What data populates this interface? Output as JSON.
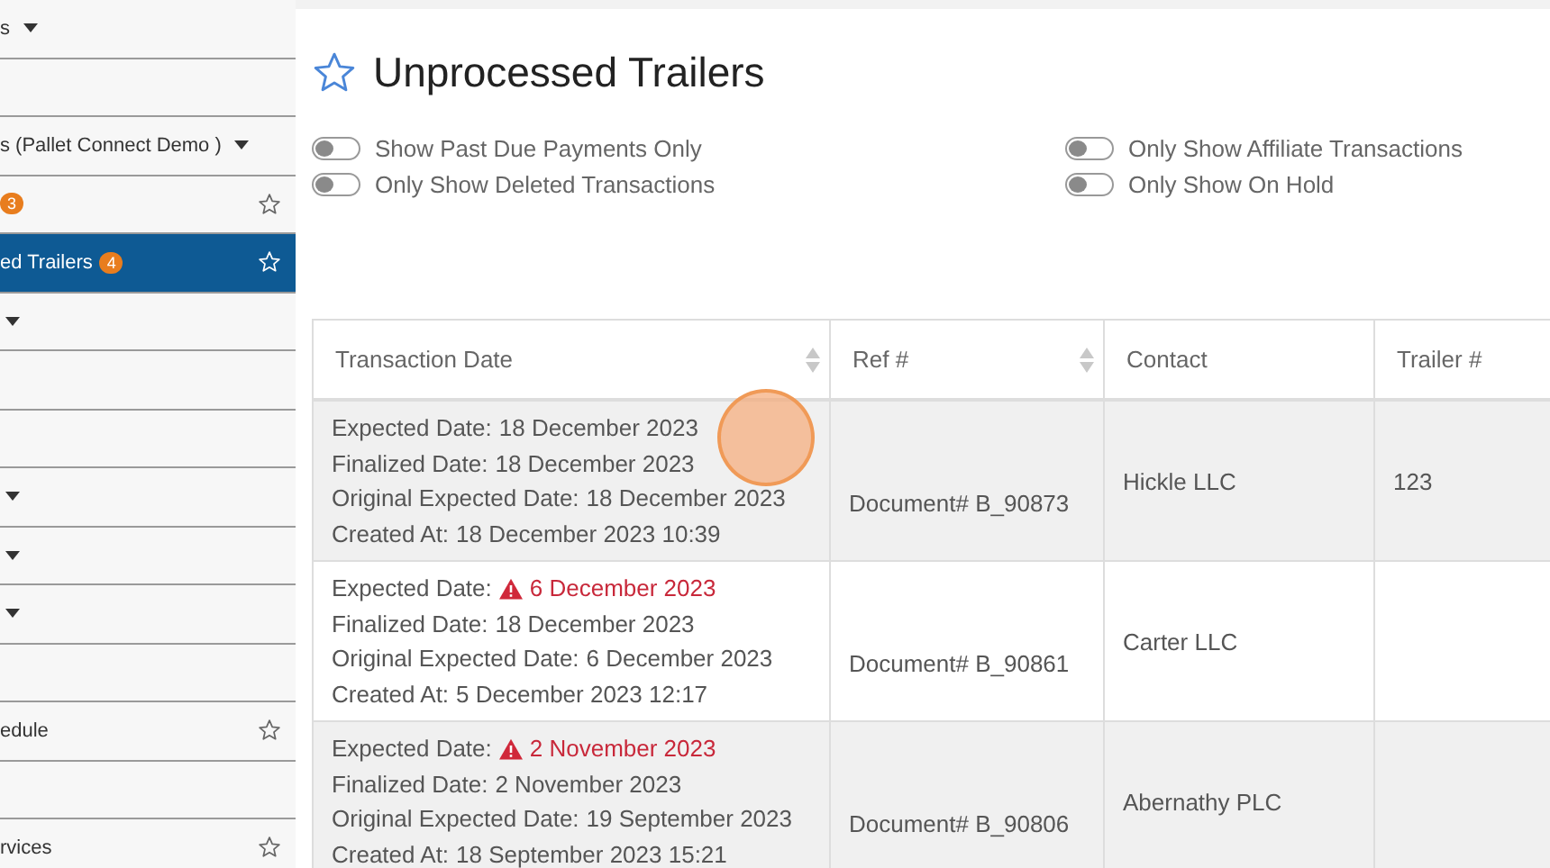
{
  "sidebar": {
    "items": [
      {
        "text": "s",
        "caret": true,
        "star": false,
        "selected": false
      },
      {
        "caret": false,
        "star": false,
        "selected": false
      },
      {
        "text": "s (Pallet Connect Demo )",
        "caret": true,
        "star": false,
        "selected": false
      },
      {
        "badge": "3",
        "caret": false,
        "star": true,
        "selected": false
      },
      {
        "text": "ed Trailers",
        "badge": "4",
        "caret": false,
        "star": true,
        "selected": true
      },
      {
        "caret": true,
        "star": false,
        "selected": false
      },
      {
        "caret": false,
        "star": false,
        "selected": false
      },
      {
        "caret": false,
        "star": false,
        "selected": false
      },
      {
        "caret": true,
        "star": false,
        "selected": false
      },
      {
        "caret": true,
        "star": false,
        "selected": false
      },
      {
        "caret": true,
        "star": false,
        "selected": false
      },
      {
        "caret": false,
        "star": false,
        "selected": false
      },
      {
        "text": "edule",
        "caret": false,
        "star": true,
        "selected": false
      },
      {
        "caret": false,
        "star": false,
        "selected": false
      },
      {
        "text": "rvices",
        "caret": false,
        "star": true,
        "selected": false
      }
    ]
  },
  "page": {
    "title": "Unprocessed Trailers",
    "favorite": false
  },
  "filters": [
    {
      "label": "Show Past Due Payments Only",
      "on": false
    },
    {
      "label": "Only Show Affiliate Transactions",
      "on": false
    },
    {
      "label": "Only Show Deleted Transactions",
      "on": false
    },
    {
      "label": "Only Show On Hold",
      "on": false
    }
  ],
  "table": {
    "columns": [
      {
        "label": "Transaction Date",
        "sortable": true
      },
      {
        "label": "Ref #",
        "sortable": true
      },
      {
        "label": "Contact",
        "sortable": false
      },
      {
        "label": "Trailer #"
      }
    ],
    "rows": [
      {
        "dates": [
          {
            "label": "Expected Date:",
            "value": "18 December 2023",
            "overdue": false
          },
          {
            "label": "Finalized Date:",
            "value": "18 December 2023",
            "overdue": false
          },
          {
            "label": "Original Expected Date:",
            "value": "18 December 2023",
            "overdue": false
          },
          {
            "label": "Created At:",
            "value": "18 December 2023 10:39",
            "overdue": false
          }
        ],
        "ref": "Document# B_90873",
        "contact": "Hickle LLC",
        "trailer": "123"
      },
      {
        "dates": [
          {
            "label": "Expected Date:",
            "value": "6 December 2023",
            "overdue": true
          },
          {
            "label": "Finalized Date:",
            "value": "18 December 2023",
            "overdue": false
          },
          {
            "label": "Original Expected Date:",
            "value": "6 December 2023",
            "overdue": false
          },
          {
            "label": "Created At:",
            "value": "5 December 2023 12:17",
            "overdue": false
          }
        ],
        "ref": "Document# B_90861",
        "contact": "Carter LLC"
      },
      {
        "dates": [
          {
            "label": "Expected Date:",
            "value": "2 November 2023",
            "overdue": true
          },
          {
            "label": "Finalized Date:",
            "value": "2 November 2023",
            "overdue": false
          },
          {
            "label": "Original Expected Date:",
            "value": "19 September 2023",
            "overdue": false
          },
          {
            "label": "Created At:",
            "value": "18 September 2023 15:21",
            "overdue": false
          }
        ],
        "ref": "Document# B_90806",
        "contact": "Abernathy PLC"
      }
    ]
  }
}
